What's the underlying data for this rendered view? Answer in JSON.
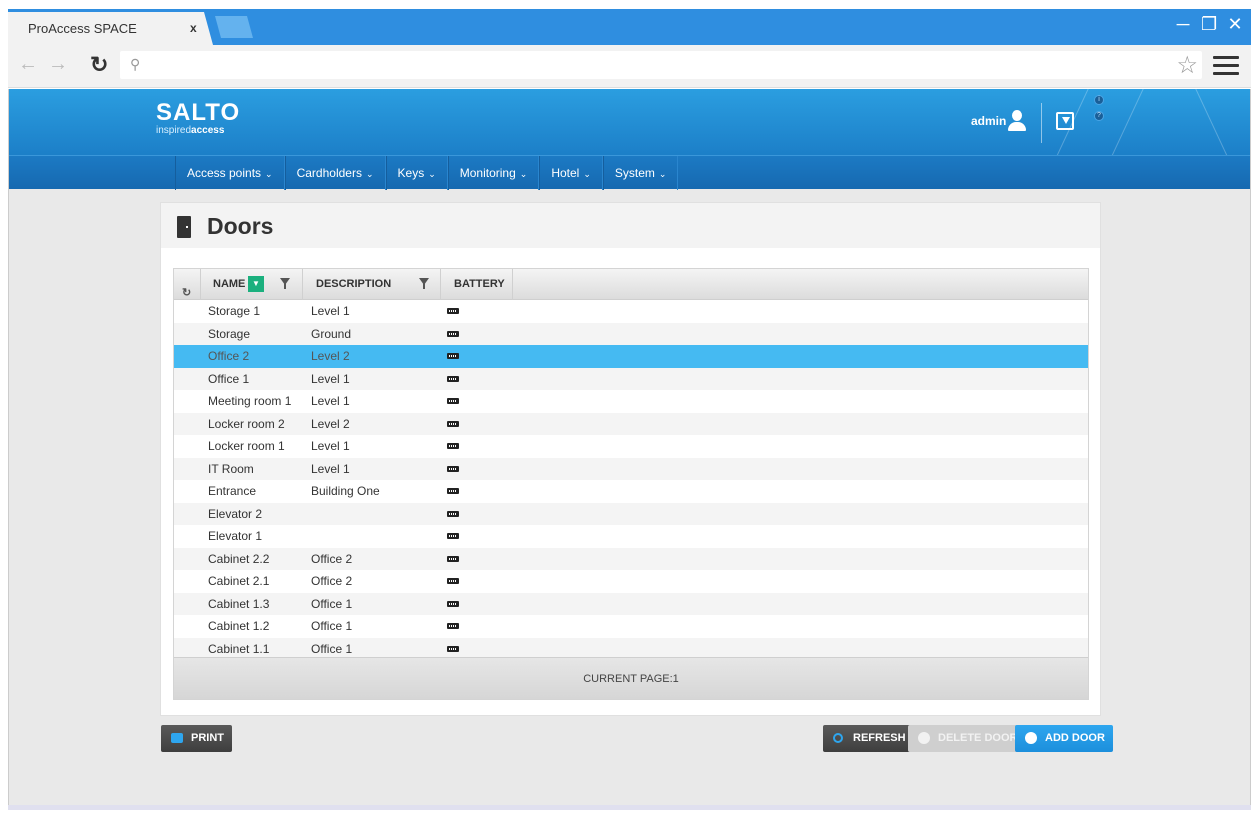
{
  "browser": {
    "tab_title": "ProAccess SPACE",
    "tab_close": "x",
    "window_controls": [
      "minimize",
      "restore",
      "close"
    ],
    "address_value": ""
  },
  "header": {
    "logo_brand": "SALTO",
    "logo_tagline_light": "inspired",
    "logo_tagline_bold": "access",
    "user_name": "admin"
  },
  "nav": {
    "items": [
      {
        "label": "Access points"
      },
      {
        "label": "Cardholders"
      },
      {
        "label": "Keys"
      },
      {
        "label": "Monitoring"
      },
      {
        "label": "Hotel"
      },
      {
        "label": "System"
      }
    ]
  },
  "page": {
    "title": "Doors"
  },
  "grid": {
    "columns": {
      "name": "NAME",
      "description": "DESCRIPTION",
      "battery": "BATTERY"
    },
    "rows": [
      {
        "name": "Storage 1",
        "description": "Level 1",
        "selected": false
      },
      {
        "name": "Storage",
        "description": "Ground",
        "selected": false
      },
      {
        "name": "Office 2",
        "description": "Level 2",
        "selected": true
      },
      {
        "name": "Office 1",
        "description": "Level 1",
        "selected": false
      },
      {
        "name": "Meeting room 1",
        "description": "Level 1",
        "selected": false
      },
      {
        "name": "Locker room 2",
        "description": "Level 2",
        "selected": false
      },
      {
        "name": "Locker room 1",
        "description": "Level 1",
        "selected": false
      },
      {
        "name": "IT Room",
        "description": "Level 1",
        "selected": false
      },
      {
        "name": "Entrance",
        "description": "Building One",
        "selected": false
      },
      {
        "name": "Elevator 2",
        "description": "",
        "selected": false
      },
      {
        "name": "Elevator 1",
        "description": "",
        "selected": false
      },
      {
        "name": "Cabinet 2.2",
        "description": "Office 2",
        "selected": false
      },
      {
        "name": "Cabinet 2.1",
        "description": "Office 2",
        "selected": false
      },
      {
        "name": "Cabinet 1.3",
        "description": "Office 1",
        "selected": false
      },
      {
        "name": "Cabinet 1.2",
        "description": "Office 1",
        "selected": false
      },
      {
        "name": "Cabinet 1.1",
        "description": "Office 1",
        "selected": false
      }
    ],
    "footer": "CURRENT PAGE:1"
  },
  "buttons": {
    "print": "PRINT",
    "refresh": "REFRESH",
    "delete_door": "DELETE DOOR",
    "add_door": "ADD DOOR"
  },
  "colors": {
    "accent": "#2b9ee0",
    "selected_row": "#45baf2",
    "sort_green": "#1bb07e",
    "add_button": "#1c8fdc"
  }
}
